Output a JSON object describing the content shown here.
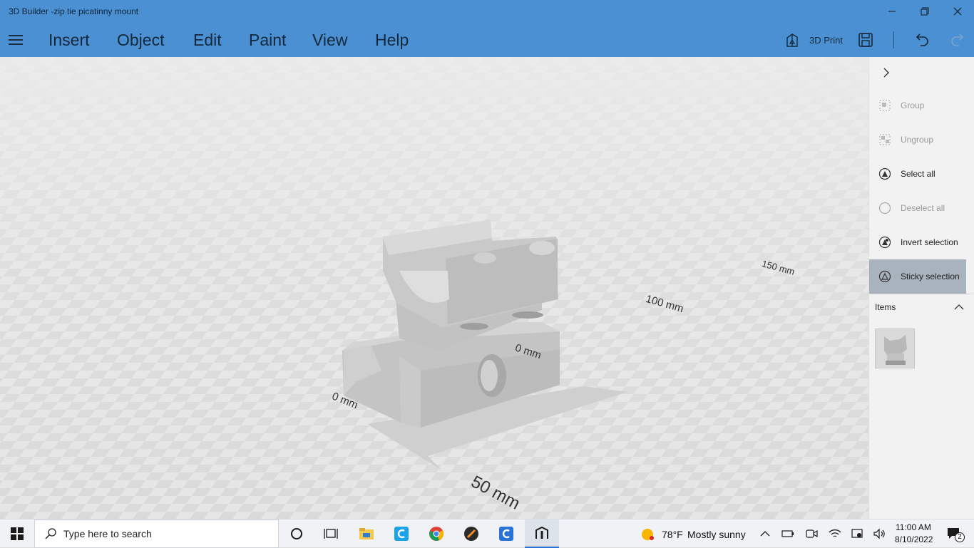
{
  "window": {
    "title": "3D Builder -zip tie picatinny mount",
    "minimize_icon": "minimize-icon",
    "restore_icon": "restore-icon",
    "close_icon": "close-icon"
  },
  "menu": {
    "items": [
      "Insert",
      "Object",
      "Edit",
      "Paint",
      "View",
      "Help"
    ],
    "print_label": "3D Print"
  },
  "viewport": {
    "scale_labels": [
      "0 mm",
      "50 mm",
      "0 mm",
      "100 mm",
      "150 mm"
    ]
  },
  "panel": {
    "actions": [
      {
        "label": "Group",
        "icon": "group-icon",
        "enabled": false
      },
      {
        "label": "Ungroup",
        "icon": "ungroup-icon",
        "enabled": false
      },
      {
        "label": "Select all",
        "icon": "select-all-icon",
        "enabled": true
      },
      {
        "label": "Deselect all",
        "icon": "deselect-all-icon",
        "enabled": false
      },
      {
        "label": "Invert selection",
        "icon": "invert-selection-icon",
        "enabled": true
      },
      {
        "label": "Sticky selection",
        "icon": "sticky-selection-icon",
        "enabled": true,
        "active": true
      }
    ],
    "items_label": "Items"
  },
  "taskbar": {
    "search_placeholder": "Type here to search",
    "weather_temp": "78°F",
    "weather_text": "Mostly sunny",
    "time": "11:00 AM",
    "date": "8/10/2022",
    "notification_count": "2"
  },
  "colors": {
    "accent": "#4a90d2",
    "active_panel_item": "#a9b3bd"
  }
}
